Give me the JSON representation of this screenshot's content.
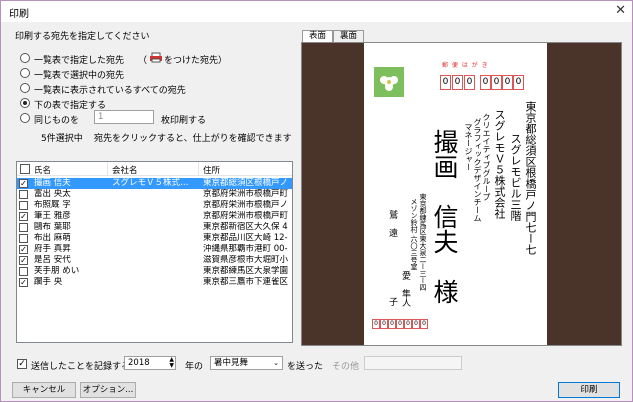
{
  "window": {
    "title": "印刷",
    "close_glyph": "✕"
  },
  "section_title": "印刷する宛先を指定してください",
  "options": {
    "o1": "一覧表で指定した宛先",
    "o1_note_open": "（",
    "o1_note": "をつけた宛先）",
    "o2": "一覧表で選択中の宛先",
    "o3": "一覧表に表示されているすべての宛先",
    "o4": "下の表で指定する",
    "o5": "同じものを",
    "o5_count": "1",
    "o5_suffix": "枚印刷する"
  },
  "status": {
    "selected": "5件選択中",
    "hint": "宛先をクリックすると、仕上がりを確認できます"
  },
  "list": {
    "headers": {
      "name": "氏名",
      "company": "会社名",
      "address": "住所"
    },
    "rows": [
      {
        "checked": true,
        "name": "撮画 信夫",
        "company": "スグレモＶ５株式…",
        "address": "東京都総須区根橋戸ノ"
      },
      {
        "checked": false,
        "name": "富出 央太",
        "company": "",
        "address": "京都府栄洲市根橋戸町"
      },
      {
        "checked": false,
        "name": "布照厩 字",
        "company": "",
        "address": "京都府栄洲市根橋戸ノ"
      },
      {
        "checked": true,
        "name": "筆王 雅彦",
        "company": "",
        "address": "京都府栄洲市根橋戸町"
      },
      {
        "checked": false,
        "name": "鷗布 葉耶",
        "company": "",
        "address": "東京都新宿区大久保 4"
      },
      {
        "checked": false,
        "name": "布出 麻萌",
        "company": "",
        "address": "東京都品川区大崎 12-"
      },
      {
        "checked": true,
        "name": "府手 真昇",
        "company": "",
        "address": "沖縄県那覇市港町 00-"
      },
      {
        "checked": true,
        "name": "是呂 安代",
        "company": "",
        "address": "滋賀県彦根市大堀町小"
      },
      {
        "checked": false,
        "name": "芙手朋 めい",
        "company": "",
        "address": "東京都練馬区大泉学園"
      },
      {
        "checked": true,
        "name": "躙手 央",
        "company": "",
        "address": "東京都三鷹市下連雀区"
      }
    ]
  },
  "tabs": [
    "表面",
    "裏面"
  ],
  "postcard": {
    "label": "郵 便 は が き",
    "postal_digits": [
      "0",
      "0",
      "0",
      "0",
      "0",
      "0",
      "0"
    ],
    "address1": "東京都総須区根橋戸ノ門七ー七",
    "address2": "スグレモビル三階",
    "company": "スグレモＶ５株式会社",
    "dept1": "クリエイティブグループ",
    "dept2": "グラフィックデザインチーム",
    "position": "マネージャー",
    "recipient": "撮画　信夫　様",
    "sender_address": "東京都練馬区東大泉二ー三ー四",
    "sender_address2": "メゾン鈴村 六〇三号室",
    "sender1": "鷲　遠",
    "sender2": "愛　隼人",
    "sender3": "子",
    "sender_postal": [
      "0",
      "0",
      "0",
      "0",
      "0",
      "0",
      "0"
    ]
  },
  "footer": {
    "record_label": "送信したことを記録する",
    "year": "2018",
    "year_suffix": "年の",
    "type": "暑中見舞",
    "sent_label": "を送った",
    "other_label": "その他",
    "cancel": "キャンセル",
    "options": "オプション...",
    "print": "印刷"
  }
}
